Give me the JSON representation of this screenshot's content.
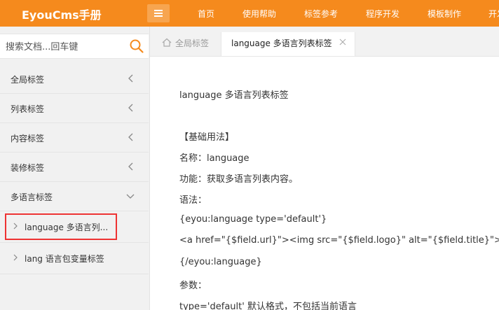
{
  "header": {
    "logo": "EyouCms手册",
    "nav": [
      "首页",
      "使用帮助",
      "标签参考",
      "程序开发",
      "模板制作",
      "开发"
    ],
    "accent_color": "#f58a1d"
  },
  "sidebar": {
    "search_placeholder": "搜索文档...回车键",
    "items": [
      {
        "label": "全局标签",
        "icon": "chevron-left-icon"
      },
      {
        "label": "列表标签",
        "icon": "chevron-left-icon"
      },
      {
        "label": "内容标签",
        "icon": "chevron-left-icon"
      },
      {
        "label": "装修标签",
        "icon": "chevron-left-icon"
      },
      {
        "label": "多语言标签",
        "icon": "chevron-down-icon"
      }
    ],
    "subitems": [
      {
        "label": "language 多语言列...",
        "icon": "chevron-right-icon"
      },
      {
        "label": "lang 语言包变量标签",
        "icon": "chevron-right-icon"
      }
    ]
  },
  "tabs": {
    "home": "全局标签",
    "active": "language 多语言列表标签"
  },
  "content": {
    "lines": [
      "language 多语言列表标签",
      "【基础用法】",
      "名称：language",
      "功能：获取多语言列表内容。",
      "语法：",
      "{eyou:language type='default'}",
      "<a href=\"{$field.url}\"><img src=\"{$field.logo}\" alt=\"{$field.title}\">{$field.title}</a>",
      "{/eyou:language}",
      "参数：",
      "type='default' 默认格式，不包括当前语言"
    ]
  }
}
